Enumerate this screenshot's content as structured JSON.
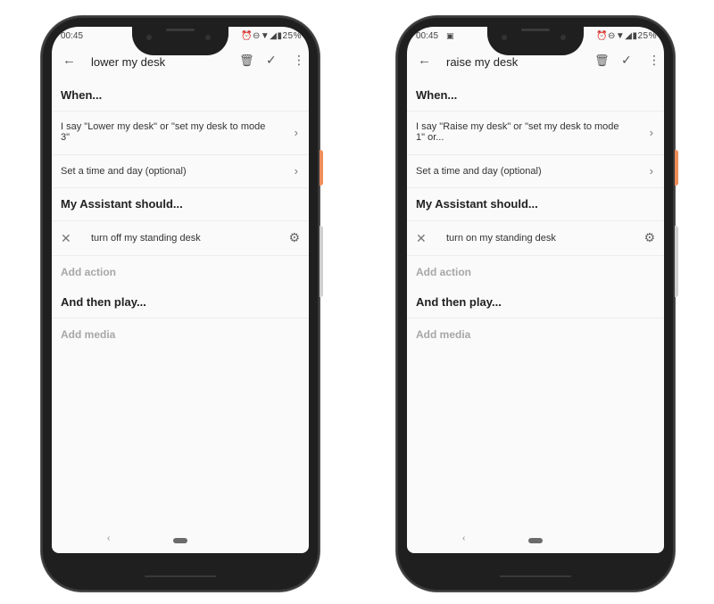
{
  "phones": [
    {
      "status_time": "00:45",
      "status_icons": "⏰⊖▼◢▮25%",
      "status_extra": "",
      "title": "lower my desk",
      "when_heading": "When...",
      "trigger_text": "I say \"Lower my desk\" or \"set my desk to mode 3\"",
      "schedule_text": "Set a time and day (optional)",
      "assistant_heading": "My Assistant should...",
      "action_text": "turn off my standing desk",
      "add_action": "Add action",
      "then_heading": "And then play...",
      "add_media": "Add media"
    },
    {
      "status_time": "00:45",
      "status_icons": "⏰⊖▼◢▮25%",
      "status_extra": "▣",
      "title": "raise my desk",
      "when_heading": "When...",
      "trigger_text": "I say \"Raise my desk\" or \"set my desk to mode 1\" or...",
      "schedule_text": "Set a time and day (optional)",
      "assistant_heading": "My Assistant should...",
      "action_text": "turn on my standing desk",
      "add_action": "Add action",
      "then_heading": "And then play...",
      "add_media": "Add media"
    }
  ],
  "icons": {
    "back": "←",
    "trash": "🗑",
    "check": "✓",
    "more": "⋮",
    "chevron": "›",
    "close": "✕",
    "gear": "⚙",
    "nav_back": "‹"
  },
  "colors": {
    "accent_button": "#ef8d5a",
    "muted_text": "#a7a7a7"
  }
}
